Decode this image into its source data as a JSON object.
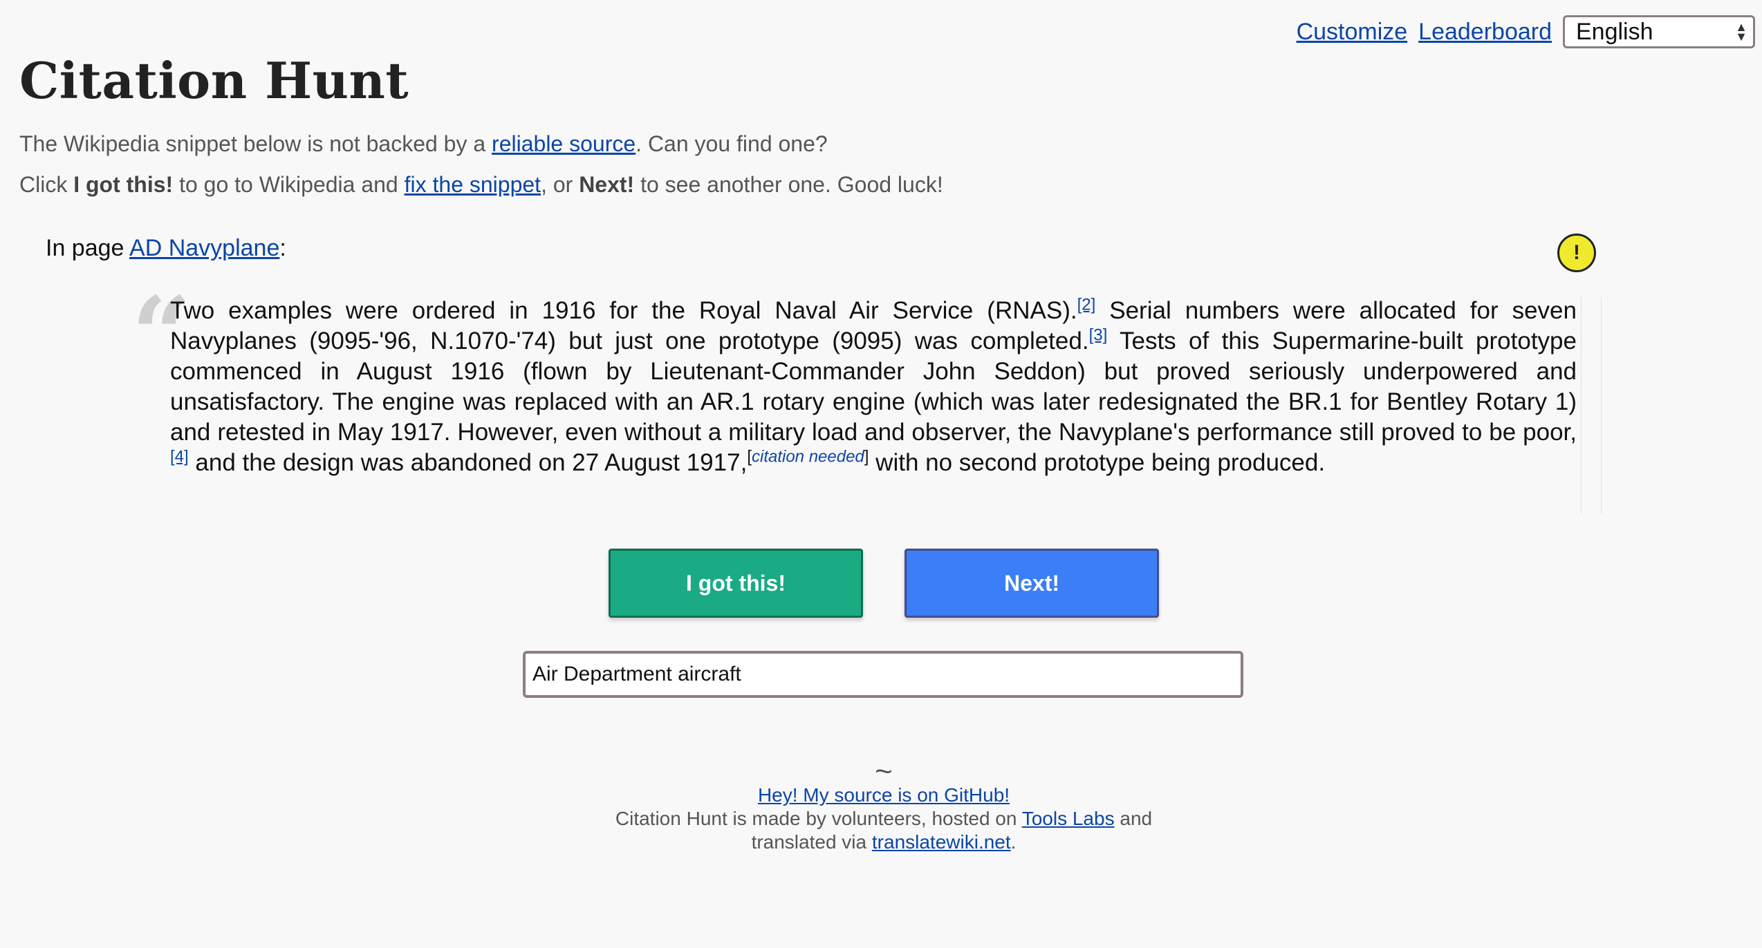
{
  "nav": {
    "customize": "Customize",
    "leaderboard": "Leaderboard",
    "language": "English"
  },
  "title": "Citation Hunt",
  "intro": {
    "line1_before": "The Wikipedia snippet below is not backed by a ",
    "line1_link": "reliable source",
    "line1_after": ". Can you find one?",
    "line2_click": "Click ",
    "line2_gotthis": "I got this!",
    "line2_mid": " to go to Wikipedia and ",
    "line2_link": "fix the snippet",
    "line2_or": ", or ",
    "line2_next": "Next!",
    "line2_after": " to see another one. Good luck!"
  },
  "page": {
    "prefix": "In page ",
    "link": "AD Navyplane",
    "suffix": ":",
    "warning_symbol": "!"
  },
  "snippet": {
    "quote_mark": "“",
    "seg1": "Two examples were ordered in 1916 for the Royal Naval Air Service (RNAS).",
    "ref1": "[2]",
    "seg2": " Serial numbers were allocated for seven Navyplanes (9095-'96, N.1070-'74) but just one prototype (9095) was completed.",
    "ref2": "[3]",
    "seg3": " Tests of this Supermarine-built prototype commenced in August 1916 (flown by Lieutenant-Commander John Seddon) but proved seriously underpowered and unsatisfactory. The engine was replaced with an AR.1 rotary engine (which was later redesignated the BR.1 for Bentley Rotary 1) and retested in May 1917. However, even without a military load and observer, the Navyplane's performance still proved to be poor,",
    "ref3": "[4]",
    "seg4": " and the design was abandoned on 27 August 1917,",
    "cn_open": "[",
    "cn_text": "citation needed",
    "cn_close": "]",
    "seg5": " with no second prototype being produced."
  },
  "buttons": {
    "got_this": "I got this!",
    "next": "Next!"
  },
  "search": {
    "value": "Air Department aircraft"
  },
  "footer": {
    "tilde": "~",
    "github": "Hey! My source is on GitHub!",
    "line2_before": "Citation Hunt is made by volunteers, hosted on ",
    "line2_link": "Tools Labs",
    "line2_after": " and",
    "line3_before": "translated via ",
    "line3_link": "translatewiki.net",
    "line3_after": "."
  },
  "colors": {
    "got_this_bg": "#1aab85",
    "next_bg": "#3c7ef5",
    "warning_bg": "#f0ea2e",
    "link": "#0b45a8"
  }
}
